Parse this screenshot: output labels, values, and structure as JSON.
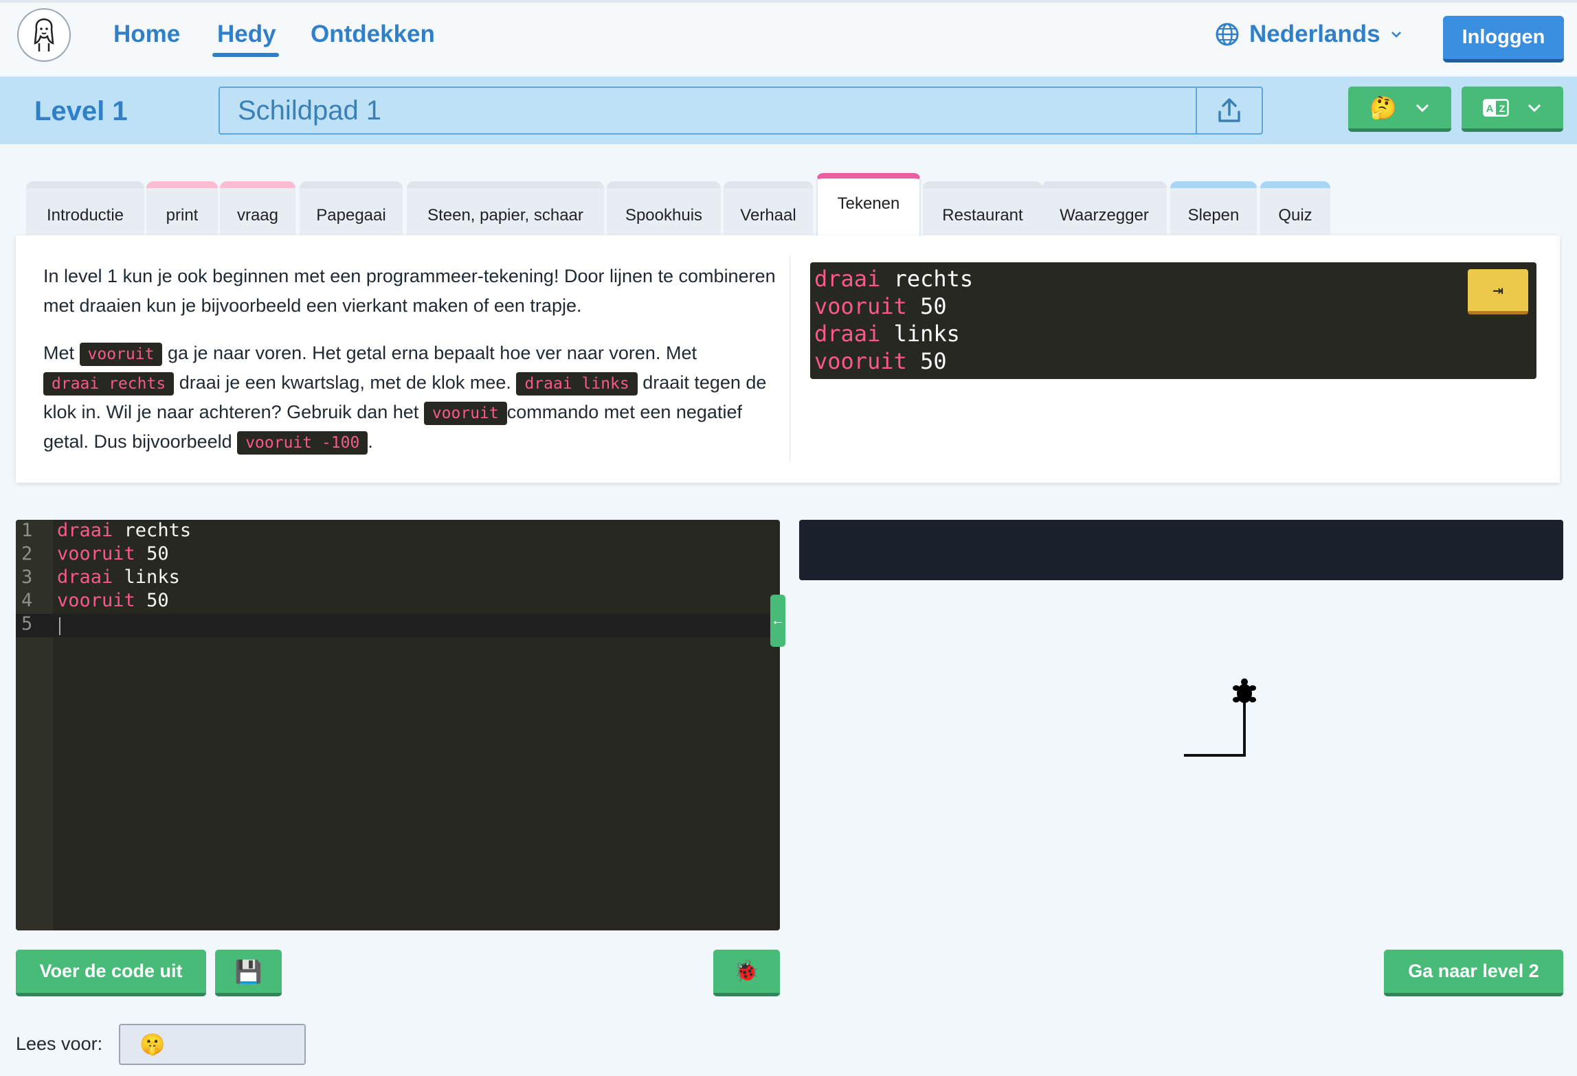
{
  "nav": {
    "links": [
      "Home",
      "Hedy",
      "Ontdekken"
    ],
    "active": "Hedy",
    "language": "Nederlands",
    "login_label": "Inloggen"
  },
  "levelbar": {
    "title": "Level 1",
    "program_name": "Schildpad 1",
    "emoji_dropdown_icon": "🤔",
    "translate_icon": "translate-icon"
  },
  "tabs": [
    {
      "label": "Introductie"
    },
    {
      "label": "print"
    },
    {
      "label": "vraag"
    },
    {
      "label": "Papegaai"
    },
    {
      "label": "Steen, papier, schaar"
    },
    {
      "label": "Spookhuis"
    },
    {
      "label": "Verhaal"
    },
    {
      "label": "Tekenen",
      "active": true
    },
    {
      "label": "Restaurant"
    },
    {
      "label": "Waarzegger"
    },
    {
      "label": "Slepen"
    },
    {
      "label": "Quiz"
    }
  ],
  "explanation": {
    "para1": "In level 1 kun je ook beginnen met een programmeer-tekening! Door lijnen te combineren met draaien kun je bijvoorbeeld een vierkant maken of een trapje.",
    "p2_t1": "Met",
    "p2_c1": "vooruit",
    "p2_t2": "ga je naar voren. Het getal erna bepaalt hoe ver naar voren. Met",
    "p2_c2": "draai rechts",
    "p2_t3": "draai je een kwartslag, met de klok mee.",
    "p2_c3": "draai links",
    "p2_t4": "draait tegen de klok in. Wil je naar achteren? Gebruik dan het",
    "p2_c4": "vooruit",
    "p2_t5": "commando met een negatief getal. Dus bijvoorbeeld",
    "p2_c5": "vooruit -100",
    "p2_t6": "."
  },
  "example_code": [
    {
      "kw": "draai",
      "arg": "rechts"
    },
    {
      "kw": "vooruit",
      "arg": "50"
    },
    {
      "kw": "draai",
      "arg": "links"
    },
    {
      "kw": "vooruit",
      "arg": "50"
    }
  ],
  "copy_icon": "⇥",
  "editor": {
    "lines": [
      {
        "num": "1",
        "kw": "draai",
        "arg": "rechts"
      },
      {
        "num": "2",
        "kw": "vooruit",
        "arg": "50"
      },
      {
        "num": "3",
        "kw": "draai",
        "arg": "links"
      },
      {
        "num": "4",
        "kw": "vooruit",
        "arg": "50"
      },
      {
        "num": "5",
        "kw": "",
        "arg": ""
      }
    ],
    "handle_icon": "←"
  },
  "buttons": {
    "run": "Voer de code uit",
    "save_icon": "💾",
    "debug_icon": "🐞",
    "next_level": "Ga naar level 2"
  },
  "read_aloud": {
    "label": "Lees voor:",
    "selected_icon": "🤫"
  },
  "colors": {
    "brand_blue": "#2f80c8",
    "green": "#48bb78",
    "keyword_pink": "#f8598a",
    "editor_bg": "#272822",
    "active_tab": "#e860a0"
  }
}
